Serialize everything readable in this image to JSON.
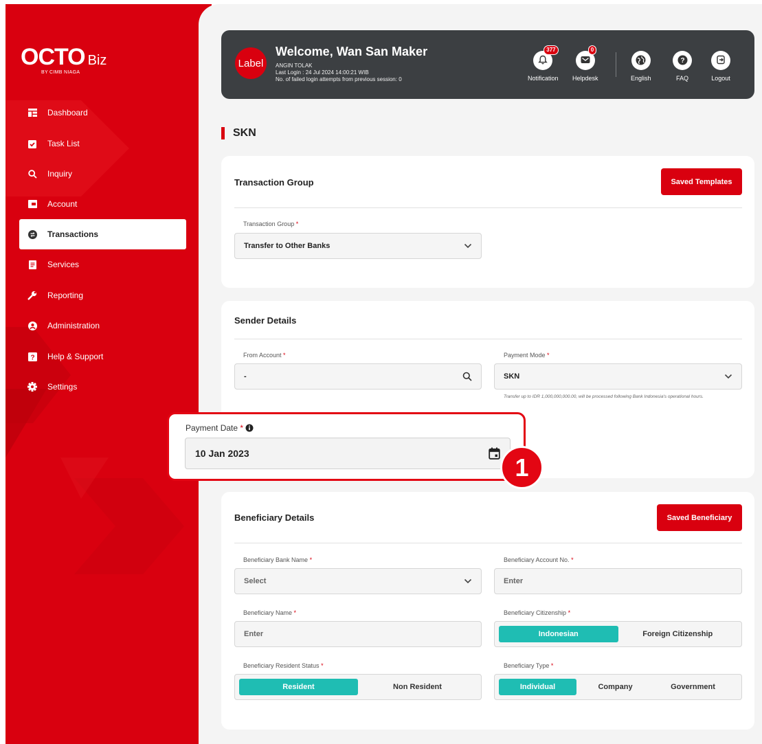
{
  "brand": {
    "name": "OCTO",
    "suffix": "Biz",
    "sub": "BY CIMB NIAGA"
  },
  "sidebar": {
    "items": [
      {
        "label": "Dashboard",
        "icon": "dashboard-icon"
      },
      {
        "label": "Task List",
        "icon": "task-list-icon"
      },
      {
        "label": "Inquiry",
        "icon": "search-icon"
      },
      {
        "label": "Account",
        "icon": "wallet-icon"
      },
      {
        "label": "Transactions",
        "icon": "transfer-icon",
        "active": true
      },
      {
        "label": "Services",
        "icon": "document-icon"
      },
      {
        "label": "Reporting",
        "icon": "wrench-icon"
      },
      {
        "label": "Administration",
        "icon": "user-circle-icon"
      },
      {
        "label": "Help & Support",
        "icon": "help-icon"
      },
      {
        "label": "Settings",
        "icon": "gear-icon"
      }
    ]
  },
  "header": {
    "avatar_label": "Label",
    "welcome": "Welcome, Wan San Maker",
    "company": "ANGIN TOLAK",
    "last_login": "Last Login : 24 Jul 2024 14:00:21 WIB",
    "failed_attempts": "No. of failed login attempts from previous session: 0",
    "notification_label": "Notification",
    "notification_count": "377",
    "helpdesk_label": "Helpdesk",
    "helpdesk_count": "0",
    "language_label": "English",
    "faq_label": "FAQ",
    "logout_label": "Logout"
  },
  "page": {
    "title": "SKN"
  },
  "transaction_group": {
    "title": "Transaction Group",
    "saved_templates": "Saved Templates",
    "field_label": "Transaction Group",
    "value": "Transfer to Other Banks"
  },
  "sender": {
    "title": "Sender Details",
    "from_label": "From Account",
    "from_value": "-",
    "mode_label": "Payment Mode",
    "mode_value": "SKN",
    "mode_note": "Transfer up to IDR 1,000,000,000.00, will be processed following Bank Indonesia's operational hours."
  },
  "payment_date": {
    "label": "Payment Date",
    "required": "*",
    "value": "10 Jan 2023",
    "step": "1"
  },
  "beneficiary": {
    "title": "Beneficiary Details",
    "saved_beneficiary": "Saved Beneficiary",
    "bank_label": "Beneficiary Bank Name",
    "bank_placeholder": "Select",
    "account_label": "Beneficiary Account No.",
    "account_placeholder": "Enter",
    "name_label": "Beneficiary Name",
    "name_placeholder": "Enter",
    "citizenship_label": "Beneficiary Citizenship",
    "citizenship_options": [
      "Indonesian",
      "Foreign Citizenship"
    ],
    "citizenship_selected": "Indonesian",
    "resident_label": "Beneficiary Resident Status",
    "resident_options": [
      "Resident",
      "Non Resident"
    ],
    "resident_selected": "Resident",
    "type_label": "Beneficiary Type",
    "type_options": [
      "Individual",
      "Company",
      "Government"
    ],
    "type_selected": "Individual"
  },
  "required_mark": "*",
  "colors": {
    "brand_red": "#d9000f",
    "teal": "#1fbdb3",
    "header_bg": "#3c3f42"
  }
}
